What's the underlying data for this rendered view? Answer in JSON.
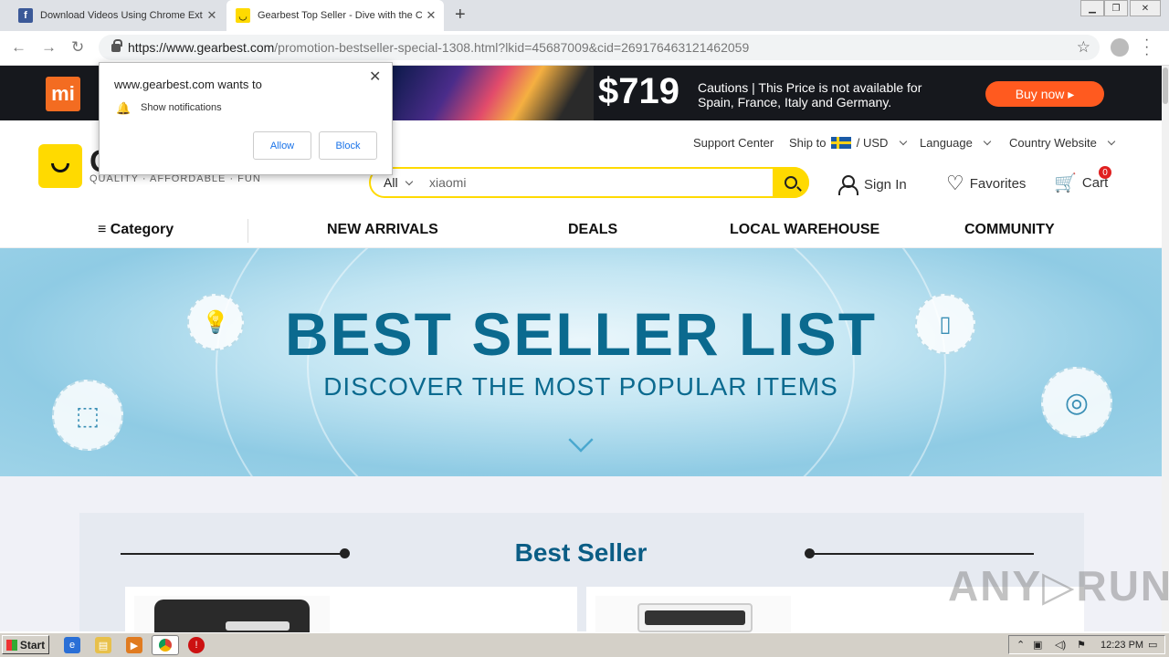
{
  "browser": {
    "tabs": [
      {
        "label": "Download Videos Using Chrome Exte",
        "icon": "facebook-icon",
        "active": false
      },
      {
        "label": "Gearbest Top Seller - Dive with the C",
        "icon": "gearbest-icon",
        "active": true
      }
    ],
    "url_host": "https://www.gearbest.com",
    "url_rest": "/promotion-bestseller-special-1308.html?lkid=45687009&cid=269176463121462059"
  },
  "notification": {
    "title": "www.gearbest.com wants to",
    "text": "Show notifications",
    "allow": "Allow",
    "block": "Block"
  },
  "promo": {
    "brand": "mi",
    "price": "$719",
    "caution_line1": "Cautions | This Price is not available for",
    "caution_line2": "Spain, France, Italy and Germany.",
    "button": "Buy now ▸"
  },
  "header": {
    "tagline": "QUALITY · AFFORDABLE · FUN",
    "support": "Support Center",
    "ship_to": "Ship to",
    "currency": "/ USD",
    "language": "Language",
    "country": "Country Website",
    "search_category": "All",
    "search_value": "xiaomi",
    "sign_in": "Sign In",
    "favorites": "Favorites",
    "cart": "Cart",
    "cart_count": "0"
  },
  "nav": {
    "category": "Category",
    "items": [
      "NEW ARRIVALS",
      "DEALS",
      "LOCAL WAREHOUSE",
      "COMMUNITY"
    ]
  },
  "hero": {
    "title": "BEST SELLER LIST",
    "subtitle": "DISCOVER THE MOST POPULAR ITEMS"
  },
  "section": {
    "title": "Best Seller"
  },
  "watermark": "ANY▷RUN",
  "taskbar": {
    "start": "Start",
    "time": "12:23 PM"
  },
  "colors": {
    "brand_yellow": "#ffda00",
    "hero_text": "#0b6a8f",
    "buy_now": "#ff5a1f"
  }
}
